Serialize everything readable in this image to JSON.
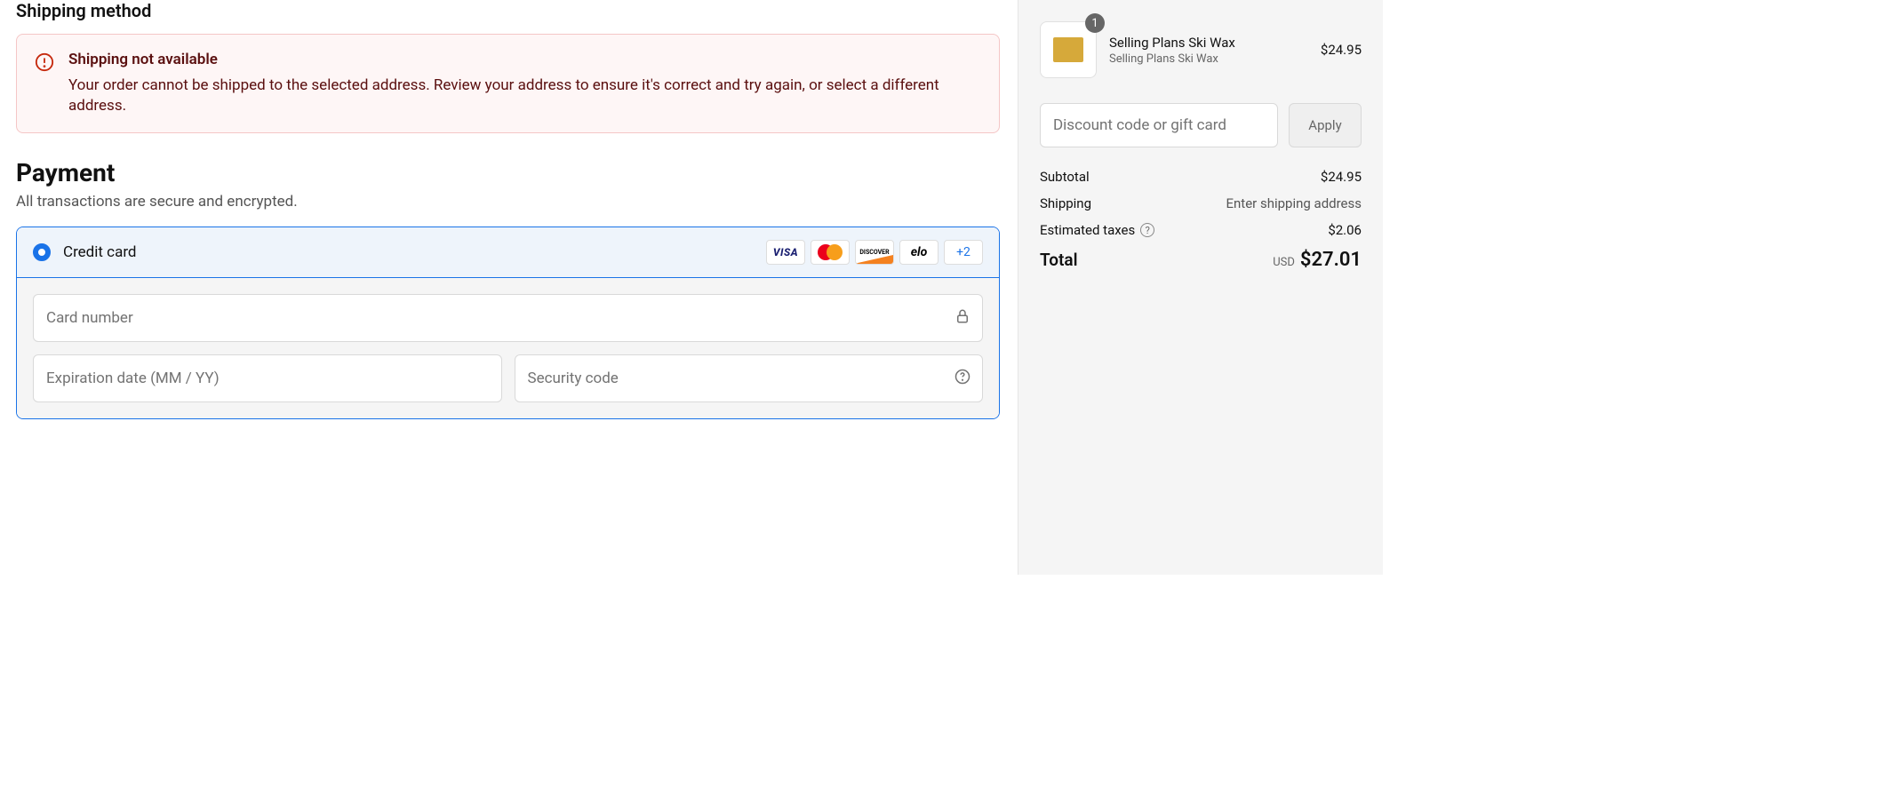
{
  "shipping": {
    "section_title": "Shipping method",
    "alert_title": "Shipping not available",
    "alert_text": "Your order cannot be shipped to the selected address. Review your address to ensure it's correct and try again, or select a different address."
  },
  "payment": {
    "title": "Payment",
    "subtitle": "All transactions are secure and encrypted.",
    "option_label": "Credit card",
    "more_cards": "+2",
    "card_number_placeholder": "Card number",
    "expiry_placeholder": "Expiration date (MM / YY)",
    "security_placeholder": "Security code"
  },
  "cart": {
    "item": {
      "qty": "1",
      "name": "Selling Plans Ski Wax",
      "variant": "Selling Plans Ski Wax",
      "price": "$24.95"
    },
    "discount_placeholder": "Discount code or gift card",
    "apply_label": "Apply",
    "subtotal_label": "Subtotal",
    "subtotal_value": "$24.95",
    "shipping_label": "Shipping",
    "shipping_value": "Enter shipping address",
    "taxes_label": "Estimated taxes",
    "taxes_value": "$2.06",
    "total_label": "Total",
    "total_currency": "USD",
    "total_value": "$27.01"
  }
}
